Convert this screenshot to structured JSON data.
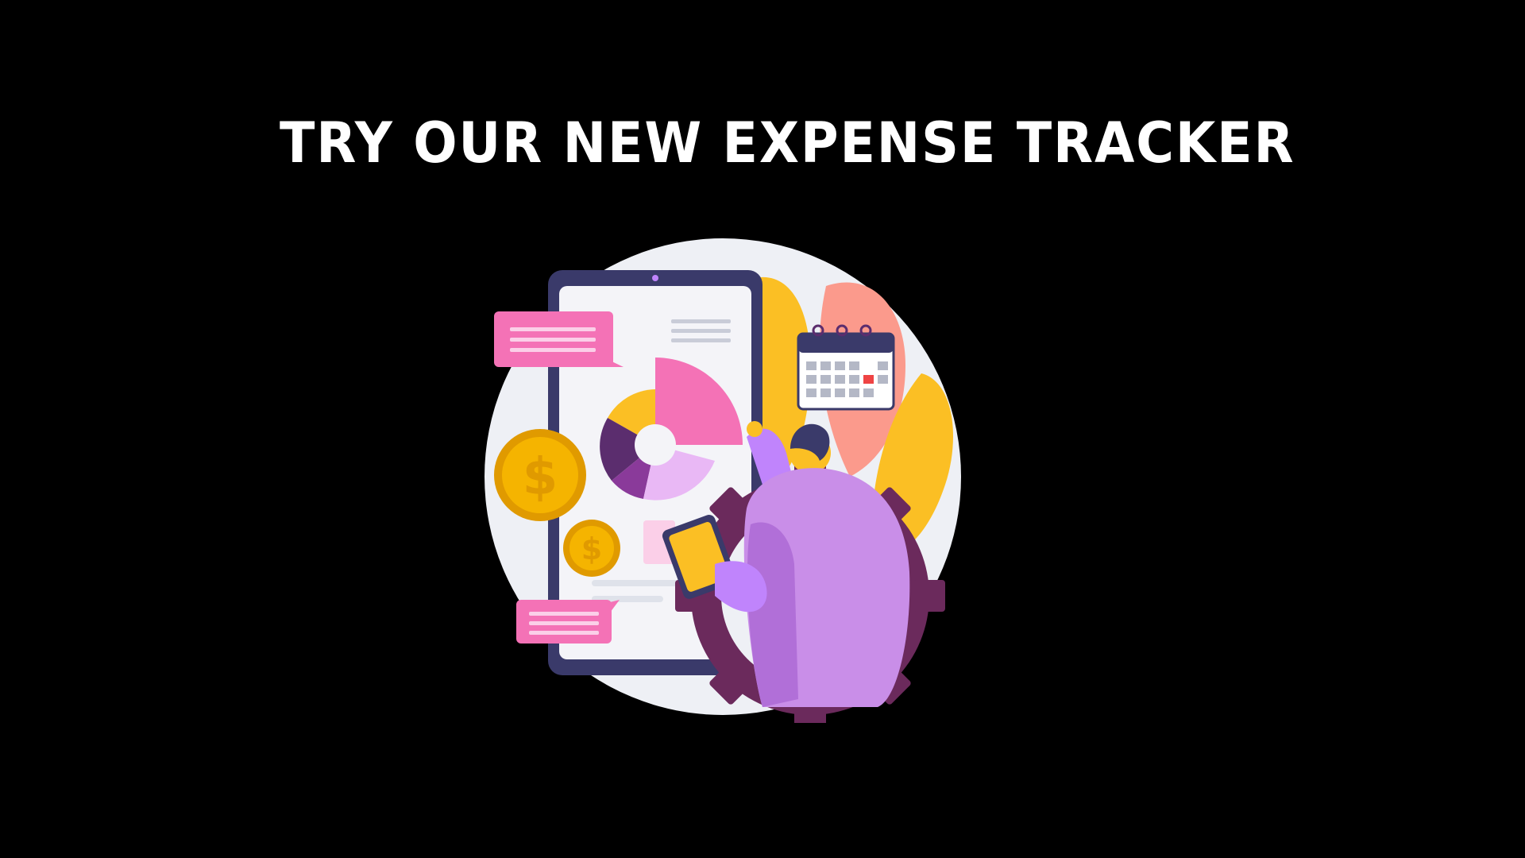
{
  "headline": "TRY OUR NEW EXPENSE TRACKER",
  "colors": {
    "background": "#000000",
    "headline": "#ffffff",
    "backdrop_circle": "#eef0f5",
    "phone_frame": "#3a3a6a",
    "phone_screen": "#f4f4f8",
    "pink": "#f472b6",
    "light_pink": "#fbcfe8",
    "purple_dark": "#5b2d6e",
    "purple": "#c084fc",
    "purple_light": "#e9b8f5",
    "orange": "#fbbf24",
    "coral": "#fb9a8c",
    "coin_gold": "#f5b400",
    "gear": "#6b2a5c",
    "calendar_red": "#ef4444"
  },
  "icons": {
    "pie_chart": "pie-chart-icon",
    "calendar": "calendar-icon",
    "coin_large": "dollar-coin-icon",
    "coin_small": "dollar-coin-icon",
    "gear": "gear-icon",
    "message_top": "message-bubble-icon",
    "message_bottom": "message-bubble-icon"
  }
}
